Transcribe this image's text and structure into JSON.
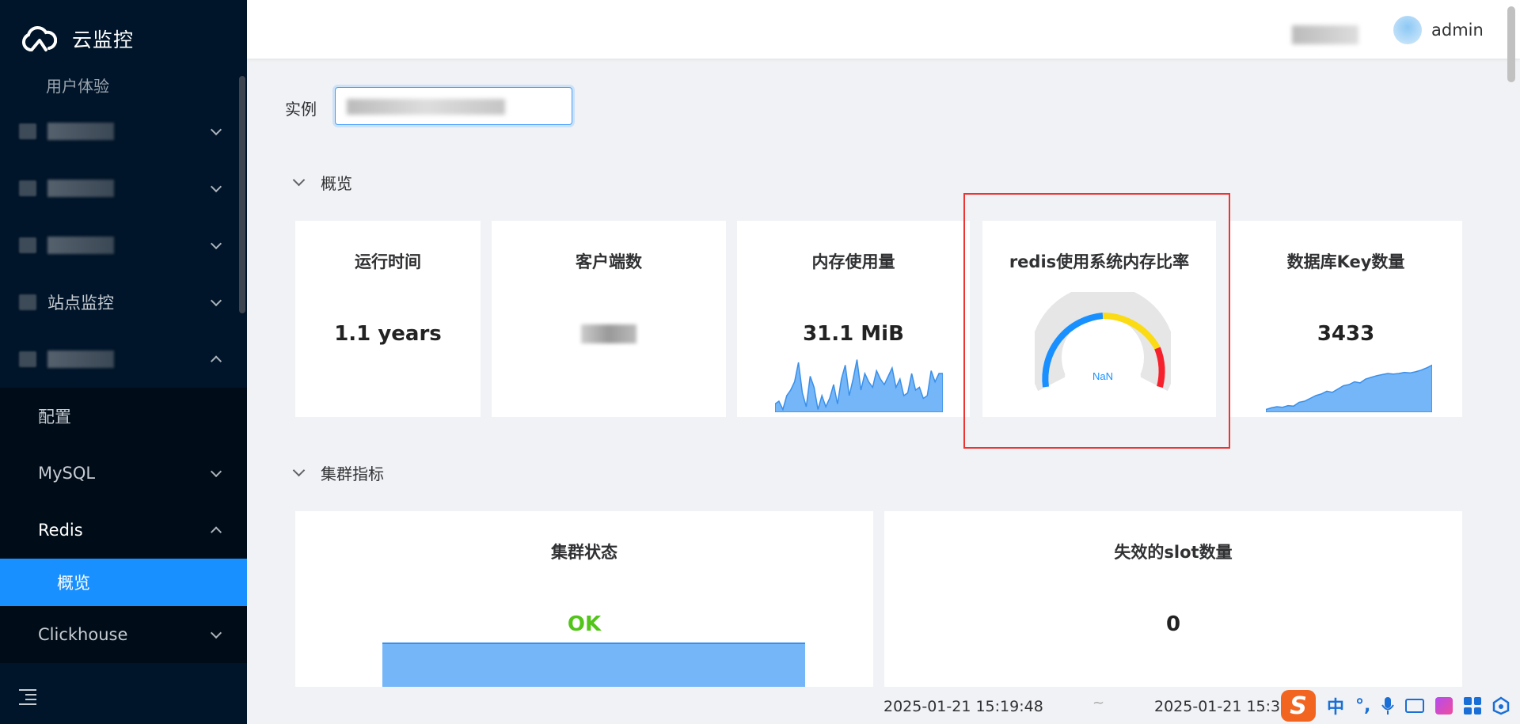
{
  "app": {
    "title": "云监控"
  },
  "sidebar": {
    "partial_top_label": "用户体验",
    "items": [
      {
        "label": "",
        "expanded": false
      },
      {
        "label": "",
        "expanded": false
      },
      {
        "label": "",
        "expanded": false
      },
      {
        "label": "站点监控",
        "expanded": false
      },
      {
        "label": "",
        "expanded": true
      }
    ],
    "sub_items": {
      "config": "配置",
      "mysql": "MySQL",
      "redis": "Redis",
      "redis_overview": "概览",
      "clickhouse": "Clickhouse"
    }
  },
  "header": {
    "user": "admin"
  },
  "filter": {
    "instance_label": "实例"
  },
  "sections": {
    "overview": "概览",
    "cluster": "集群指标"
  },
  "cards": {
    "uptime": {
      "title": "运行时间",
      "value": "1.1 years"
    },
    "clients": {
      "title": "客户端数"
    },
    "memory": {
      "title": "内存使用量",
      "value": "31.1 MiB",
      "spark": [
        0.15,
        0.2,
        0.05,
        0.3,
        0.4,
        0.55,
        0.9,
        0.35,
        0.1,
        0.65,
        0.45,
        0.05,
        0.3,
        0.1,
        0.25,
        0.5,
        0.15,
        0.6,
        0.85,
        0.3,
        0.6,
        0.95,
        0.4,
        0.7,
        0.55,
        0.45,
        0.75,
        0.6,
        0.5,
        0.65,
        0.8,
        0.45,
        0.6,
        0.3,
        0.35,
        0.7,
        0.4,
        0.45,
        0.25,
        0.3,
        0.75,
        0.55,
        0.7,
        0.7
      ]
    },
    "redis_ratio": {
      "title": "redis使用系统内存比率",
      "value": "NaN",
      "gauge_colors": [
        "#1890ff",
        "#fadb14",
        "#f5222d"
      ]
    },
    "db_keys": {
      "title": "数据库Key数量",
      "value": "3433",
      "spark": [
        0.05,
        0.08,
        0.1,
        0.09,
        0.12,
        0.11,
        0.18,
        0.2,
        0.25,
        0.3,
        0.33,
        0.38,
        0.36,
        0.42,
        0.48,
        0.5,
        0.55,
        0.53,
        0.6,
        0.63,
        0.66,
        0.68,
        0.7,
        0.69,
        0.7,
        0.72,
        0.71,
        0.73,
        0.76,
        0.8,
        0.85
      ]
    },
    "cluster_status": {
      "title": "集群状态",
      "value": "OK"
    },
    "failed_slots": {
      "title": "失效的slot数量",
      "value": "0"
    }
  },
  "time_range": {
    "start": "2025-01-21 15:19:48",
    "separator": "~",
    "end": "2025-01-21 15:34"
  },
  "ime": {
    "mode": "中",
    "punct": "°,"
  }
}
